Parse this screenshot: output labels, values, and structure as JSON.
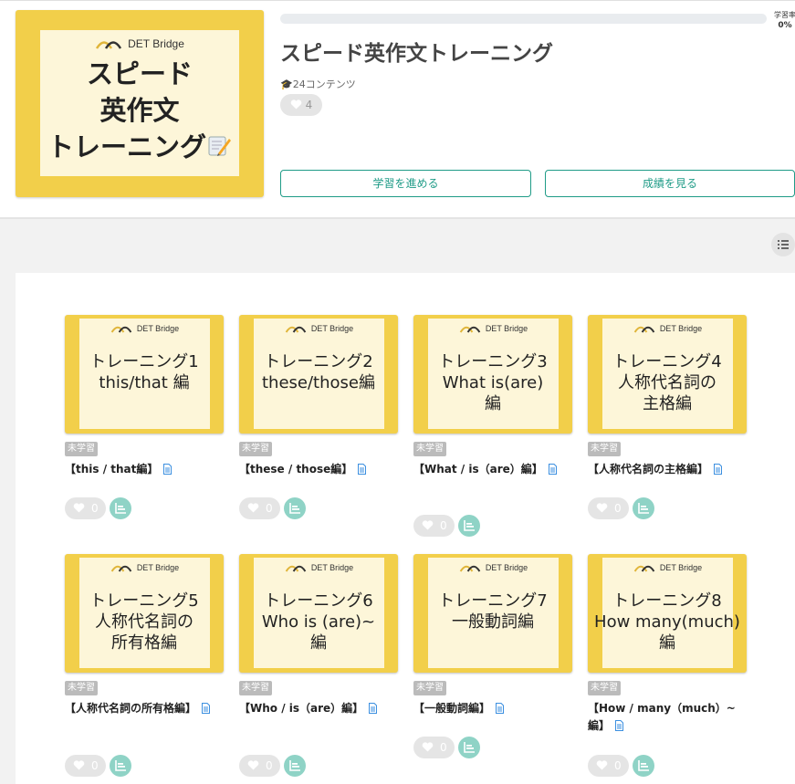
{
  "course": {
    "brand": "DET Bridge",
    "thumb_title": [
      "スピード",
      "英作文",
      "トレーニング"
    ],
    "title": "スピード英作文トレーニング",
    "contents_count": "24コンテンツ",
    "likes": "4",
    "progress_label": "学習率",
    "progress_value": "0%",
    "progress_fraction": 0,
    "btn_continue": "学習を進める",
    "btn_results": "成績を見る"
  },
  "colors": {
    "accent": "#1f9b87",
    "thumb_yellow": "#f2cf4a",
    "paper": "#fdf6d9"
  },
  "cards": [
    {
      "thumb": [
        "トレーニング1",
        "this/that 編"
      ],
      "status": "未学習",
      "title": "【this / that編】",
      "likes": "0"
    },
    {
      "thumb": [
        "トレーニング2",
        "these/those編"
      ],
      "status": "未学習",
      "title": "【these / those編】",
      "likes": "0"
    },
    {
      "thumb": [
        "トレーニング3",
        "What is(are)",
        "編"
      ],
      "status": "未学習",
      "title": "【What / is（are）編】",
      "likes": "0"
    },
    {
      "thumb": [
        "トレーニング4",
        "人称代名詞の",
        "主格編"
      ],
      "status": "未学習",
      "title": "【人称代名詞の主格編】",
      "likes": "0"
    },
    {
      "thumb": [
        "トレーニング5",
        "人称代名詞の",
        "所有格編"
      ],
      "status": "未学習",
      "title": "【人称代名詞の所有格編】",
      "likes": "0"
    },
    {
      "thumb": [
        "トレーニング6",
        "Who is (are)~",
        "編"
      ],
      "status": "未学習",
      "title": "【Who / is（are）編】",
      "likes": "0"
    },
    {
      "thumb": [
        "トレーニング7",
        "一般動詞編"
      ],
      "status": "未学習",
      "title": "【一般動詞編】",
      "likes": "0"
    },
    {
      "thumb": [
        "トレーニング8",
        "How many(much)",
        "編"
      ],
      "status": "未学習",
      "title": "【How / many（much）~編】",
      "likes": "0"
    }
  ]
}
